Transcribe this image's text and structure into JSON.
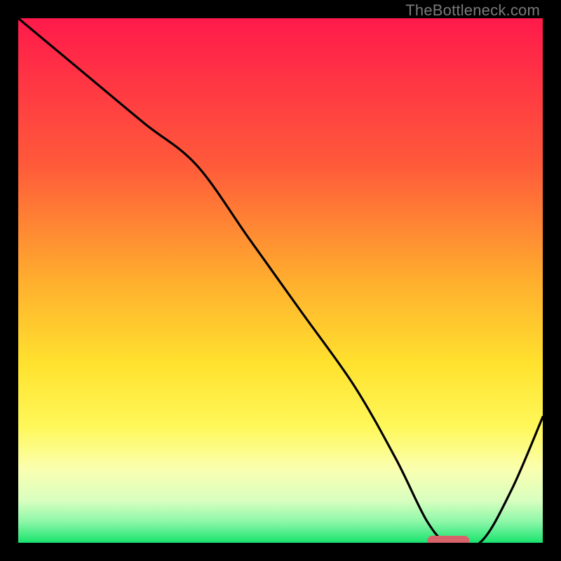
{
  "watermark": "TheBottleneck.com",
  "chart_data": {
    "type": "line",
    "title": "",
    "xlabel": "",
    "ylabel": "",
    "xlim": [
      0,
      100
    ],
    "ylim": [
      0,
      100
    ],
    "gradient_stops": [
      {
        "offset": 0,
        "color": "#ff1a4b"
      },
      {
        "offset": 28,
        "color": "#ff5a3a"
      },
      {
        "offset": 50,
        "color": "#ffae2e"
      },
      {
        "offset": 66,
        "color": "#ffe22e"
      },
      {
        "offset": 78,
        "color": "#fff85a"
      },
      {
        "offset": 86,
        "color": "#faffb0"
      },
      {
        "offset": 92,
        "color": "#d8ffc0"
      },
      {
        "offset": 96,
        "color": "#8cf7a8"
      },
      {
        "offset": 100,
        "color": "#19e36e"
      }
    ],
    "series": [
      {
        "name": "bottleneck-curve",
        "x": [
          0,
          12,
          24,
          34,
          44,
          54,
          64,
          72,
          78,
          82,
          88,
          94,
          100
        ],
        "y": [
          100,
          90,
          80,
          72,
          58,
          44,
          30,
          16,
          4,
          0,
          0,
          10,
          24
        ]
      }
    ],
    "marker": {
      "name": "optimal-range",
      "x_start": 78,
      "x_end": 86,
      "y": 0,
      "color": "#d9636a"
    }
  }
}
